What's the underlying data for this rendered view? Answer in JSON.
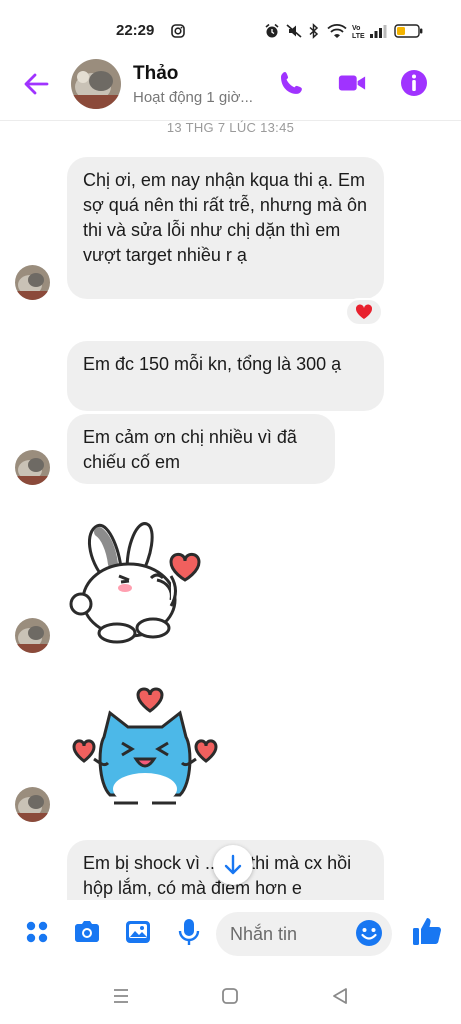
{
  "status_bar": {
    "time": "22:29",
    "icons": [
      "instagram-icon",
      "alarm-icon",
      "mute-icon",
      "bluetooth-icon",
      "wifi-icon",
      "volte-icon",
      "signal-icon",
      "battery-icon"
    ]
  },
  "header": {
    "contact_name": "Thảo",
    "activity": "Hoạt động 1 giờ...",
    "icons": [
      "back-arrow-icon",
      "phone-icon",
      "video-icon",
      "info-icon"
    ],
    "accent_color": "#a033ff"
  },
  "conversation": {
    "date_label": "13 THG 7 LÚC 13:45",
    "messages": [
      {
        "text": "Chị ơi, em nay nhận kqua thi ạ. Em sợ quá nên thi rất trễ, nhưng mà ôn thi và sửa lỗi như chị dặn thì em vượt target nhiều r ạ",
        "reaction": "heart"
      },
      {
        "text": "Em đc 150 mỗi kn, tổng là 300 ạ"
      },
      {
        "text": "Em cảm ơn chị nhiều vì đã chiếu cố em"
      },
      {
        "sticker": "white-bunny-with-heart"
      },
      {
        "sticker": "blue-cat-with-hearts"
      },
      {
        "text": "Em bị shock vì ... ng thi mà cx hồi hộp lắm, có mà điểm hơn e"
      }
    ]
  },
  "composer": {
    "placeholder": "Nhắn tin",
    "icons": [
      "menu-dots-icon",
      "camera-icon",
      "image-icon",
      "microphone-icon",
      "emoji-icon",
      "like-icon"
    ],
    "icon_color": "#1877f2"
  },
  "nav_bar": {
    "icons": [
      "recents-icon",
      "home-icon",
      "back-icon"
    ]
  }
}
